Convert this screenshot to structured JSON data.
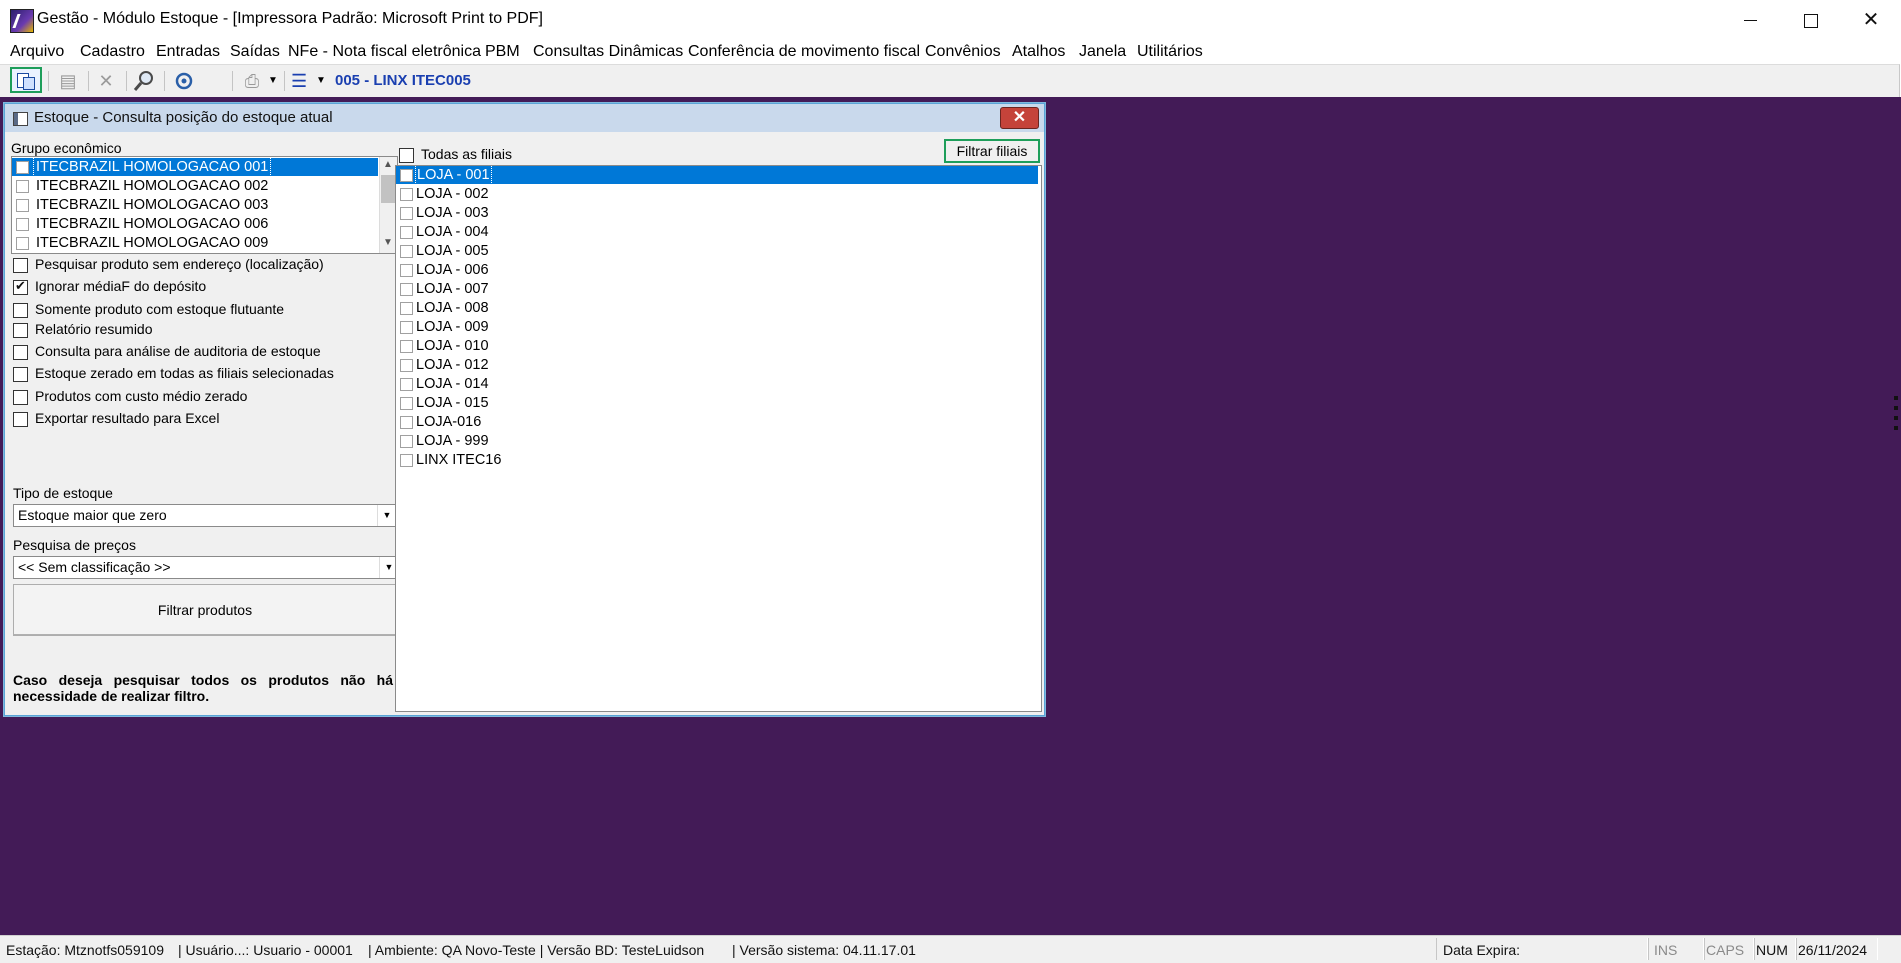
{
  "window": {
    "title": "Gestão  - Módulo Estoque - [Impressora Padrão: Microsoft Print to PDF]",
    "minimize": "",
    "maximize": "",
    "close": "✕"
  },
  "menu": [
    "Arquivo",
    "Cadastro",
    "Entradas",
    "Saídas",
    "NFe - Nota fiscal eletrônica",
    "PBM",
    "Consultas Dinâmicas",
    "Conferência de movimento fiscal",
    "Convênios",
    "Atalhos",
    "Janela",
    "Utilitários"
  ],
  "toolbar": {
    "filial": "005 - LINX ITEC005",
    "icons": [
      "new-document-icon",
      "paste-icon",
      "delete-icon",
      "search-icon",
      "refresh-icon",
      "print-icon",
      "export-icon"
    ]
  },
  "dialog": {
    "title": "Estoque - Consulta posição do estoque atual",
    "close": "✕",
    "grupo_label": "Grupo econômico",
    "grupos": [
      {
        "label": "ITECBRAZIL HOMOLOGACAO 001",
        "selected": true
      },
      {
        "label": "ITECBRAZIL HOMOLOGACAO 002",
        "selected": false
      },
      {
        "label": "ITECBRAZIL HOMOLOGACAO 003",
        "selected": false
      },
      {
        "label": "ITECBRAZIL HOMOLOGACAO 006",
        "selected": false
      },
      {
        "label": "ITECBRAZIL HOMOLOGACAO 009",
        "selected": false
      }
    ],
    "options": [
      {
        "label": "Pesquisar produto sem endereço (localização)",
        "checked": false
      },
      {
        "label": "Ignorar médiaF do depósito",
        "checked": true
      },
      {
        "label": "Somente produto com estoque flutuante",
        "checked": false
      },
      {
        "label": "Relatório resumido",
        "checked": false
      },
      {
        "label": "Consulta para análise de auditoria de estoque",
        "checked": false
      },
      {
        "label": "Estoque zerado em todas as filiais selecionadas",
        "checked": false
      },
      {
        "label": "Produtos com custo médio zerado",
        "checked": false
      },
      {
        "label": "Exportar resultado para Excel",
        "checked": false
      }
    ],
    "tipo_estoque_label": "Tipo de estoque",
    "tipo_estoque_value": "Estoque maior que zero",
    "pesquisa_precos_label": "Pesquisa de preços",
    "pesquisa_precos_value": "<< Sem classificação >>",
    "filtrar_produtos": "Filtrar produtos",
    "hint": "Caso deseja pesquisar todos os produtos não há necessidade de realizar filtro.",
    "todas_filiais": "Todas as filiais",
    "filtrar_filiais": "Filtrar filiais",
    "filiais": [
      {
        "label": "LOJA - 001",
        "selected": true
      },
      {
        "label": "LOJA - 002",
        "selected": false
      },
      {
        "label": "LOJA - 003",
        "selected": false
      },
      {
        "label": "LOJA - 004",
        "selected": false
      },
      {
        "label": "LOJA - 005",
        "selected": false
      },
      {
        "label": "LOJA - 006",
        "selected": false
      },
      {
        "label": "LOJA - 007",
        "selected": false
      },
      {
        "label": "LOJA - 008",
        "selected": false
      },
      {
        "label": "LOJA - 009",
        "selected": false
      },
      {
        "label": "LOJA - 010",
        "selected": false
      },
      {
        "label": "LOJA - 012",
        "selected": false
      },
      {
        "label": "LOJA - 014",
        "selected": false
      },
      {
        "label": "LOJA - 015",
        "selected": false
      },
      {
        "label": "LOJA-016",
        "selected": false
      },
      {
        "label": "LOJA - 999",
        "selected": false
      },
      {
        "label": "LINX ITEC16",
        "selected": false
      }
    ]
  },
  "statusbar": {
    "estacao": "Estação: Mtznotfs059109",
    "usuario": "| Usuário...: Usuario - 00001",
    "ambiente": "| Ambiente: QA Novo-Teste | Versão BD: TesteLuidson",
    "versao": "| Versão sistema: 04.11.17.01",
    "data_expira": "Data Expira:",
    "ins": "INS",
    "caps": "CAPS",
    "num": "NUM",
    "date": "26/11/2024"
  },
  "colors": {
    "mdi_background": "#431b57",
    "selection": "#0078d7",
    "filial_text": "#1a3fb0",
    "highlight_border": "#1e9e5a"
  }
}
